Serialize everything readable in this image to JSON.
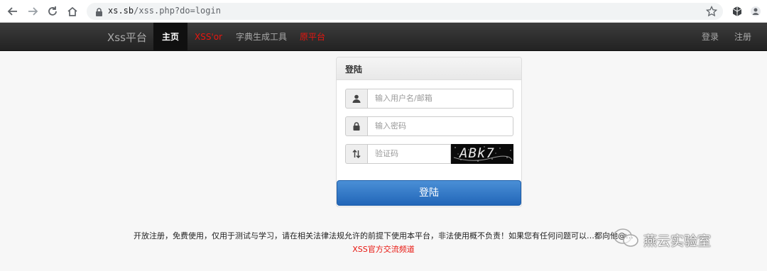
{
  "browser": {
    "url_host": "xs.sb",
    "url_path": "/xss.php?do=login",
    "icons": [
      "back-icon",
      "forward-icon",
      "reload-icon",
      "home-icon",
      "lock-icon",
      "star-icon",
      "extension-icon",
      "profile-icon"
    ]
  },
  "navbar": {
    "brand": "Xss平台",
    "items": [
      {
        "label": "主页",
        "active": true
      },
      {
        "label": "XSS'or",
        "color": "#e8160f"
      },
      {
        "label": "字典生成工具"
      },
      {
        "label": "原平台",
        "color": "#e8160f"
      }
    ],
    "right": [
      "登录",
      "注册"
    ]
  },
  "login": {
    "title": "登陆",
    "username_placeholder": "输入用户名/邮箱",
    "password_placeholder": "输入密码",
    "captcha_placeholder": "验证码",
    "captcha_text": "ABk7",
    "submit": "登陆"
  },
  "footer": {
    "notice": "开放注册，免费使用，仅用于测试与学习，请在相关法律法规允许的前提下使用本平台，非法使用概不负责！如果您有任何问题可以…都向他@…",
    "channel": "XSS官方交流频道"
  },
  "watermark": {
    "text": "燕云实验室"
  },
  "colors": {
    "navbar": "#222222",
    "accent_red": "#e8160f",
    "button_blue": "#2f76c5"
  }
}
